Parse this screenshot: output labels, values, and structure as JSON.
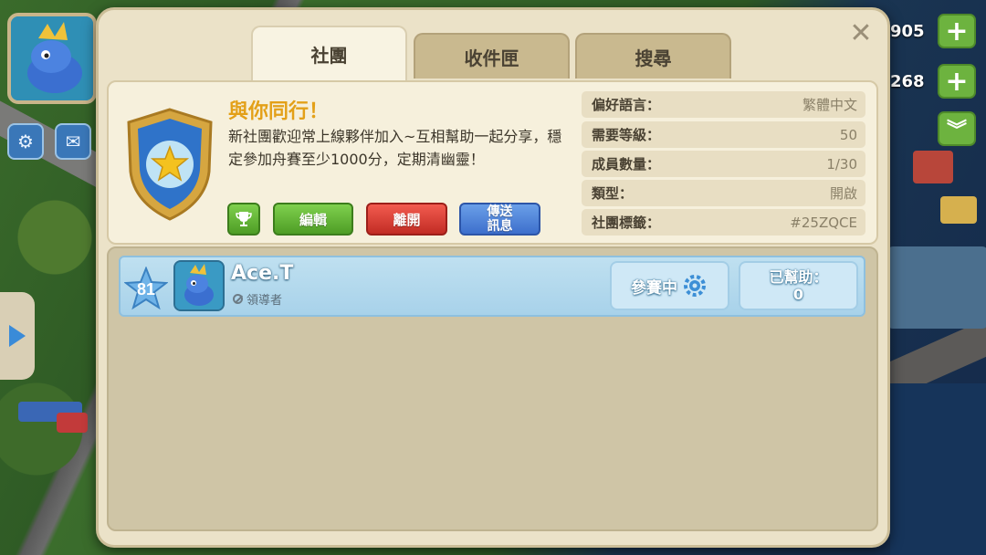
{
  "hud": {
    "resource_1": "905",
    "resource_2": "268"
  },
  "tabs": [
    {
      "label": "社團",
      "active": true
    },
    {
      "label": "收件匣",
      "active": false
    },
    {
      "label": "搜尋",
      "active": false
    }
  ],
  "club": {
    "name": "與你同行！",
    "description": "新社團歡迎常上線夥伴加入~互相幫助一起分享，穩定參加舟賽至少1000分，定期清幽靈！",
    "buttons": {
      "edit": "編輯",
      "leave": "離開",
      "send_line1": "傳送",
      "send_line2": "訊息"
    },
    "stats": [
      {
        "label": "偏好語言：",
        "value": "繁體中文"
      },
      {
        "label": "需要等級：",
        "value": "50"
      },
      {
        "label": "成員數量：",
        "value": "1/30"
      },
      {
        "label": "類型：",
        "value": "開啟"
      },
      {
        "label": "社團標籤：",
        "value": "#25ZQCE"
      }
    ]
  },
  "members": [
    {
      "level": "81",
      "name": "Ace.T",
      "role": "領導者",
      "status": "參賽中",
      "helped_label": "已幫助：",
      "helped_count": "0"
    }
  ],
  "colors": {
    "club_name": "#e3a018",
    "member_row": "#a8d2ea",
    "edit_button": "#4e9d25",
    "leave_button": "#c22c24",
    "send_button": "#3d6fcc"
  }
}
